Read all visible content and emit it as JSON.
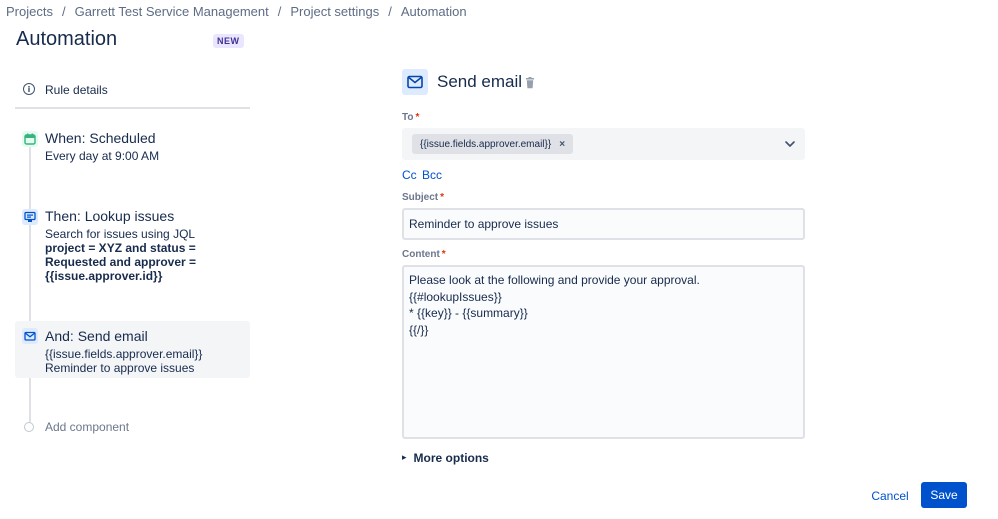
{
  "breadcrumb": [
    "Projects",
    "Garrett Test Service Management",
    "Project settings",
    "Automation"
  ],
  "page": {
    "title": "Automation",
    "badge": "NEW"
  },
  "rule_details": {
    "label": "Rule details"
  },
  "steps": [
    {
      "title": "When: Scheduled",
      "desc": [
        "Every day at 9:00 AM"
      ],
      "icon": "calendar-icon",
      "color": "#36b37e"
    },
    {
      "title": "Then: Lookup issues",
      "desc": [
        "Search for issues using JQL"
      ],
      "bold": [
        "project = XYZ and status =",
        "Requested and approver =",
        "{{issue.approver.id}}"
      ],
      "icon": "lookup-icon",
      "color": "#0065ff"
    },
    {
      "title": "And: Send email",
      "desc": [
        "{{issue.fields.approver.email}}",
        "Reminder to approve issues"
      ],
      "icon": "mail-icon",
      "color": "#0052cc"
    }
  ],
  "add_component": {
    "label": "Add component"
  },
  "action": {
    "title": "Send email"
  },
  "form": {
    "to": {
      "label": "To",
      "required": "*",
      "tag": "{{issue.fields.approver.email}}",
      "remove": "×"
    },
    "cc": "Cc",
    "bcc": "Bcc",
    "subject": {
      "label": "Subject",
      "required": "*",
      "value": "Reminder to approve issues"
    },
    "content": {
      "label": "Content",
      "required": "*",
      "lines": [
        "Please look at the following and provide your approval.",
        "{{#lookupIssues}}",
        "* {{key}} - {{summary}}",
        "{{/}}"
      ]
    },
    "more_options": "More options"
  },
  "buttons": {
    "cancel": "Cancel",
    "save": "Save"
  },
  "colors": {
    "primary": "#0052cc",
    "required": "#de350b"
  }
}
